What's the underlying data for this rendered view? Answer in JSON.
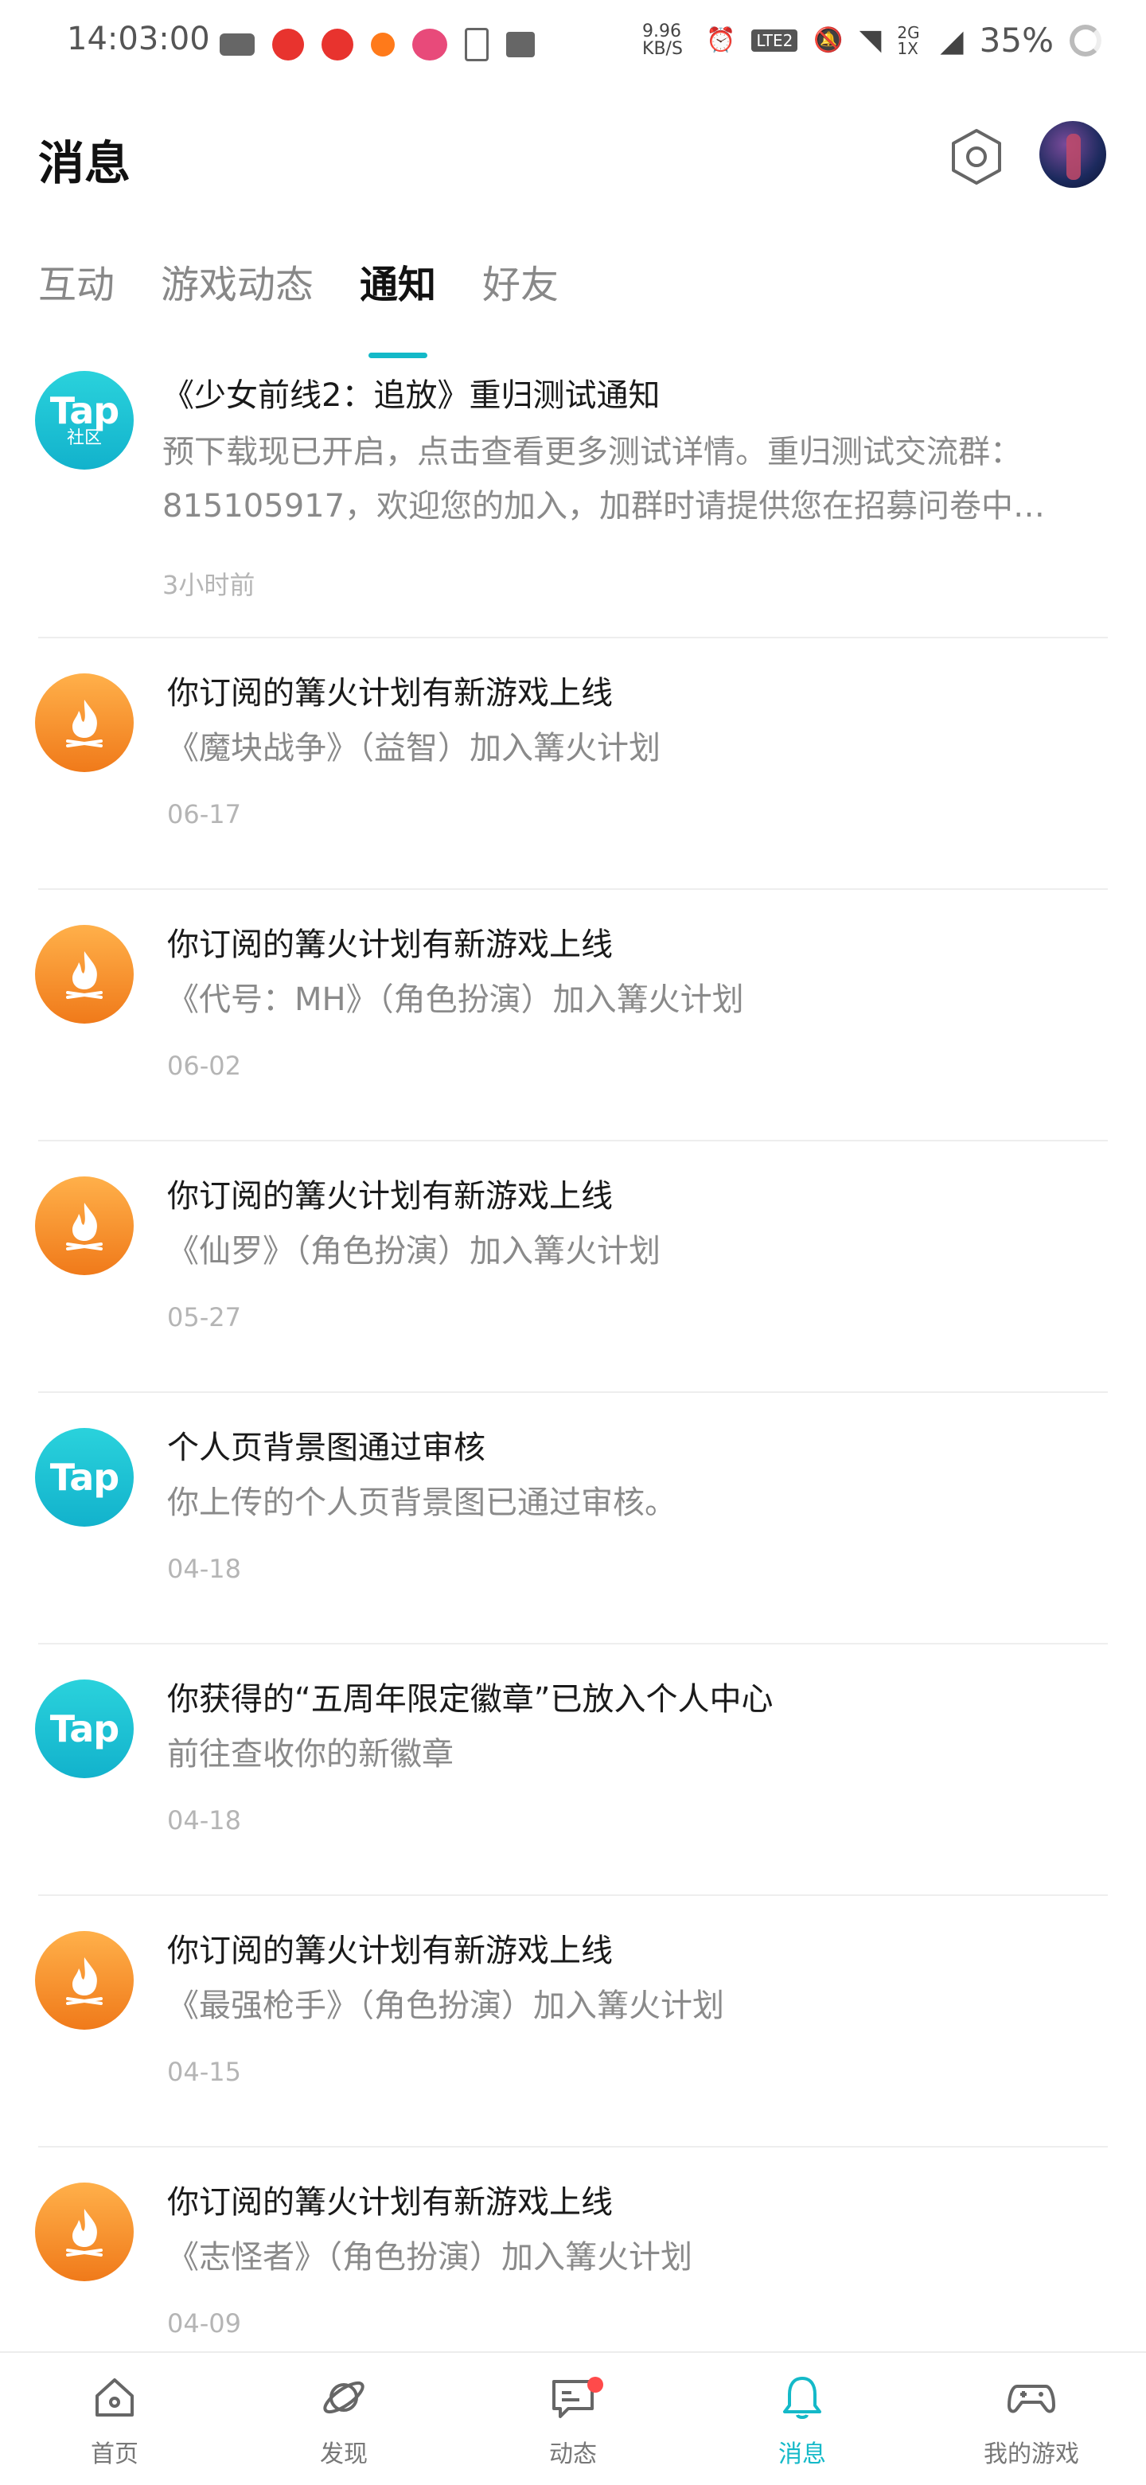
{
  "status_bar": {
    "time": "14:03:00",
    "speed": "9.96 KB/S",
    "signal": "2G 1X",
    "battery": "35%"
  },
  "header": {
    "title": "消息",
    "settings_icon": "hexagon-settings-icon",
    "avatar": "user-avatar"
  },
  "tabs": [
    {
      "label": "互动",
      "active": false
    },
    {
      "label": "游戏动态",
      "active": false
    },
    {
      "label": "通知",
      "active": true
    },
    {
      "label": "好友",
      "active": false
    }
  ],
  "notifications": [
    {
      "icon": "tap-community-icon",
      "title": "《少女前线2：追放》重归测试通知",
      "body": "预下载现已开启，点击查看更多测试详情。重归测试交流群：815105917，欢迎您的加入，加群时请提供您在招募问卷中…",
      "time": "3小时前"
    },
    {
      "icon": "campfire-icon",
      "title": "你订阅的篝火计划有新游戏上线",
      "body": "《魔块战争》（益智）加入篝火计划",
      "time": "06-17"
    },
    {
      "icon": "campfire-icon",
      "title": "你订阅的篝火计划有新游戏上线",
      "body": "《代号：MH》（角色扮演）加入篝火计划",
      "time": "06-02"
    },
    {
      "icon": "campfire-icon",
      "title": "你订阅的篝火计划有新游戏上线",
      "body": "《仙罗》（角色扮演）加入篝火计划",
      "time": "05-27"
    },
    {
      "icon": "tap-icon",
      "title": "个人页背景图通过审核",
      "body": "你上传的个人页背景图已通过审核。",
      "time": "04-18"
    },
    {
      "icon": "tap-icon",
      "title": "你获得的“五周年限定徽章”已放入个人中心",
      "body": "前往查收你的新徽章",
      "time": "04-18"
    },
    {
      "icon": "campfire-icon",
      "title": "你订阅的篝火计划有新游戏上线",
      "body": "《最强枪手》（角色扮演）加入篝火计划",
      "time": "04-15"
    },
    {
      "icon": "campfire-icon",
      "title": "你订阅的篝火计划有新游戏上线",
      "body": "《志怪者》（角色扮演）加入篝火计划",
      "time": "04-09"
    }
  ],
  "tap_icon": {
    "word": "Tap",
    "community_sub": "社区"
  },
  "bottom_nav": [
    {
      "label": "首页",
      "icon": "home-icon",
      "active": false
    },
    {
      "label": "发现",
      "icon": "planet-icon",
      "active": false
    },
    {
      "label": "动态",
      "icon": "chat-bubble-icon",
      "active": false,
      "badge": true
    },
    {
      "label": "消息",
      "icon": "bell-icon",
      "active": true
    },
    {
      "label": "我的游戏",
      "icon": "gamepad-icon",
      "active": false
    }
  ],
  "colors": {
    "accent": "#14b9c8",
    "badge": "#ff4a4a",
    "fire": "#f07a1a"
  }
}
